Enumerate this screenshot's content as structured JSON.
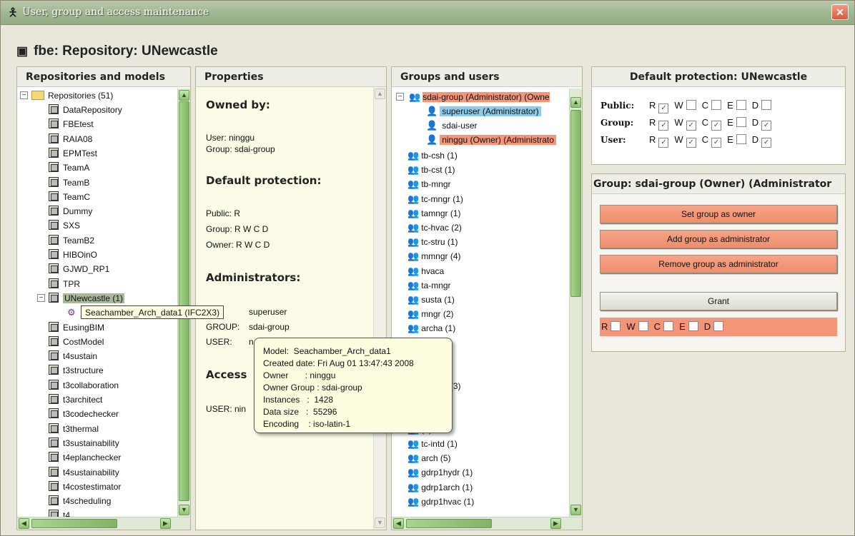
{
  "window": {
    "title": "User, group and access maintenance",
    "close_label": "✕"
  },
  "header": {
    "title": "fbe: Repository: UNewcastle"
  },
  "repos_panel": {
    "title": "Repositories and models",
    "root": "Repositories (51)",
    "items": [
      "DataRepository",
      "FBEtest",
      "RAIA08",
      "EPMTest",
      "TeamA",
      "TeamB",
      "TeamC",
      "Dummy",
      "SXS",
      "TeamB2",
      "HIBOinO",
      "GJWD_RP1",
      "TPR",
      "UNewcastle (1)",
      "",
      "EusingBIM",
      "CostModel",
      "t4sustain",
      "t3structure",
      "t3collaboration",
      "t3architect",
      "t3codechecker",
      "t3thermal",
      "t3sustainability",
      "t4eplanchecker",
      "t4sustainability",
      "t4costestimator",
      "t4scheduling",
      "t4..."
    ],
    "tooltip": "Seachamber_Arch_data1 (IFC2X3)"
  },
  "properties_panel": {
    "title": "Properties",
    "owned_by_heading": "Owned by:",
    "owner_user": "User: ninggu",
    "owner_group": "Group: sdai-group",
    "default_protection_heading": "Default protection:",
    "public_line": "Public:  R",
    "group_line": "Group:  R W C  D",
    "owner_line": "Owner:  R W C  D",
    "admins_heading": "Administrators:",
    "admin_user": "superuser",
    "admin_group_label": "GROUP:",
    "admin_group_value": "sdai-group",
    "admin_user_label": "USER:",
    "admin_user_value": "n",
    "access_heading": "Access",
    "access_user": "USER: nin"
  },
  "model_tooltip": {
    "lines": [
      "Model:  Seachamber_Arch_data1",
      "Created date: Fri Aug 01 13:47:43 2008",
      "Owner       : ninggu",
      "Owner Group : sdai-group",
      "Instances   :  1428",
      "Data size   :  55296",
      "Encoding    : iso-latin-1"
    ]
  },
  "groups_panel": {
    "title": "Groups and users",
    "root": "sdai-group (Administrator) (Owne",
    "children": [
      "superuser (Administrator)",
      "sdai-user",
      "ninggu (Owner) (Administrato"
    ],
    "groups": [
      "tb-csh (1)",
      "tb-cst (1)",
      "tb-mngr",
      "tc-mngr (1)",
      "tamngr (1)",
      "tc-hvac (2)",
      "tc-stru (1)",
      "mmngr (4)",
      "hvaca",
      "ta-mngr",
      "susta (1)",
      "mngr (2)",
      "archa (1)",
      "(3)",
      "n (1)",
      "t (1)",
      "-mngrs (3)",
      "(1)",
      "eng (1)",
      "(1)",
      "tc-intd (1)",
      "arch (5)",
      "gdrp1hydr (1)",
      "gdrp1arch (1)",
      "gdrp1hvac (1)"
    ]
  },
  "default_protection": {
    "title": "Default protection: UNewcastle",
    "rows": [
      {
        "label": "Public:",
        "flags": [
          "R",
          "W",
          "C",
          "E",
          "D"
        ],
        "checked": [
          true,
          false,
          false,
          false,
          false
        ]
      },
      {
        "label": "Group:",
        "flags": [
          "R",
          "W",
          "C",
          "E",
          "D"
        ],
        "checked": [
          true,
          true,
          true,
          false,
          true
        ]
      },
      {
        "label": "User:",
        "flags": [
          "R",
          "W",
          "C",
          "E",
          "D"
        ],
        "checked": [
          true,
          true,
          true,
          false,
          true
        ]
      }
    ]
  },
  "group_panel": {
    "title": "Group: sdai-group (Owner) (Administrator",
    "set_owner": "Set group as owner",
    "add_admin": "Add group as administrator",
    "remove_admin": "Remove group as administrator",
    "grant": "Grant",
    "grant_flags": [
      "R",
      "W",
      "C",
      "E",
      "D"
    ]
  },
  "colors": {
    "accent_orange": "#f59578",
    "highlight_blue": "#8ccbe9",
    "scroll_green": "#8fc173"
  }
}
